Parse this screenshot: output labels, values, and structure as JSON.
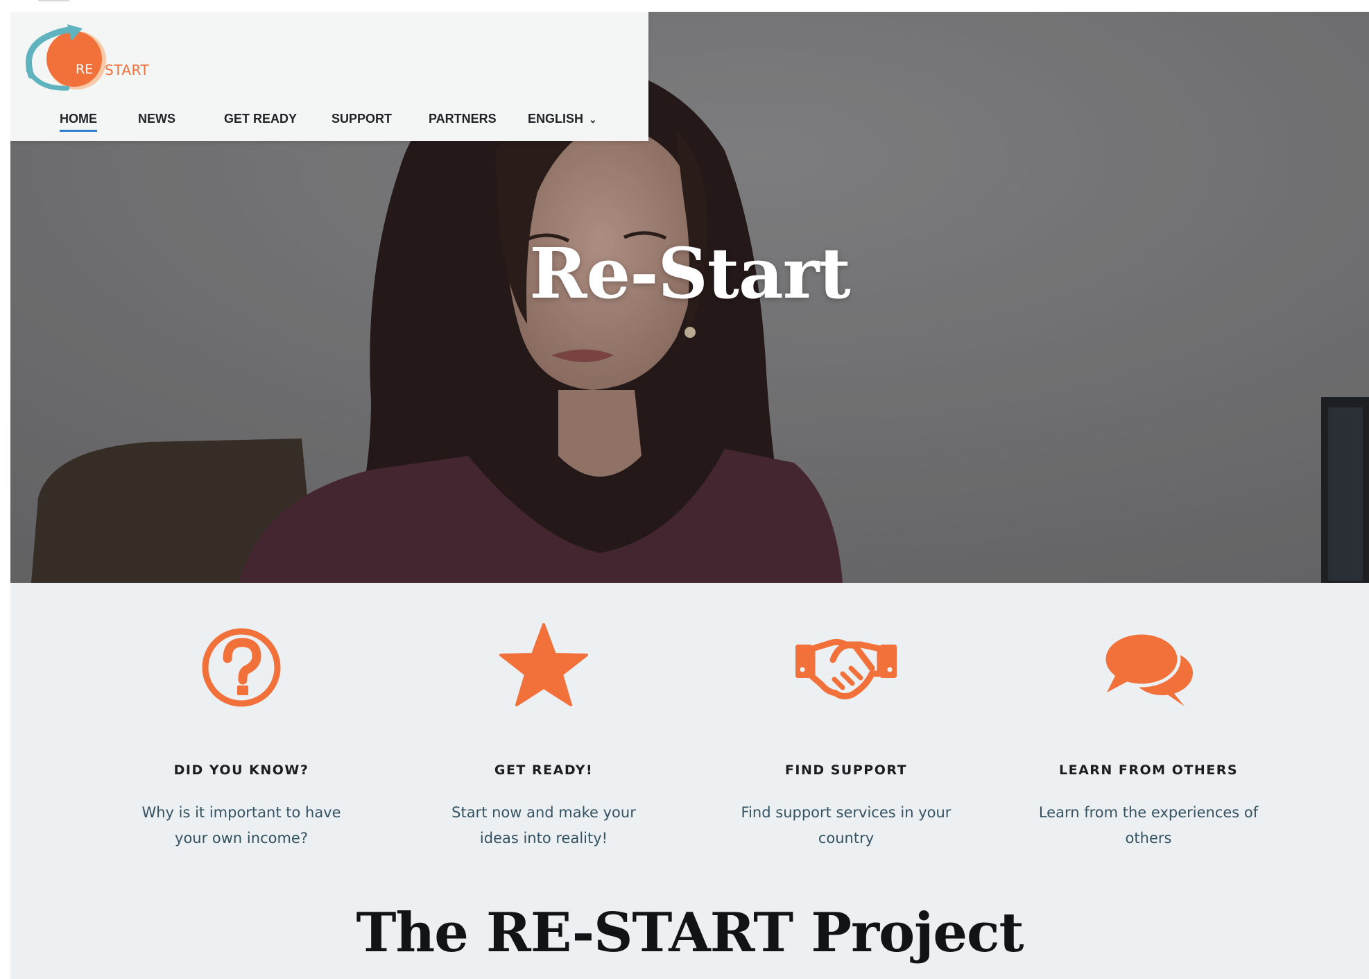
{
  "brand": {
    "logo_prefix": "RE",
    "logo_suffix": "START",
    "accent_color": "#f2713b",
    "secondary_color": "#5fb3bf"
  },
  "nav": {
    "items": [
      {
        "label": "HOME",
        "active": true
      },
      {
        "label": "NEWS",
        "active": false
      },
      {
        "label": "GET READY",
        "active": false
      },
      {
        "label": "SUPPORT",
        "active": false
      },
      {
        "label": "PARTNERS",
        "active": false
      },
      {
        "label": "ENGLISH",
        "active": false,
        "has_dropdown": true
      }
    ],
    "active_underline_color": "#2f7fd1"
  },
  "hero": {
    "title": "Re-Start"
  },
  "features": [
    {
      "icon": "question-circle-icon",
      "title": "DID YOU KNOW?",
      "text": "Why is it important to have your own income?"
    },
    {
      "icon": "star-icon",
      "title": "GET READY!",
      "text": "Start now and make your ideas into reality!"
    },
    {
      "icon": "handshake-icon",
      "title": "FIND SUPPORT",
      "text": "Find support services in your country"
    },
    {
      "icon": "chat-bubbles-icon",
      "title": "LEARN FROM OTHERS",
      "text": "Learn from the experiences of others"
    }
  ],
  "section": {
    "title": "The RE-START Project"
  }
}
